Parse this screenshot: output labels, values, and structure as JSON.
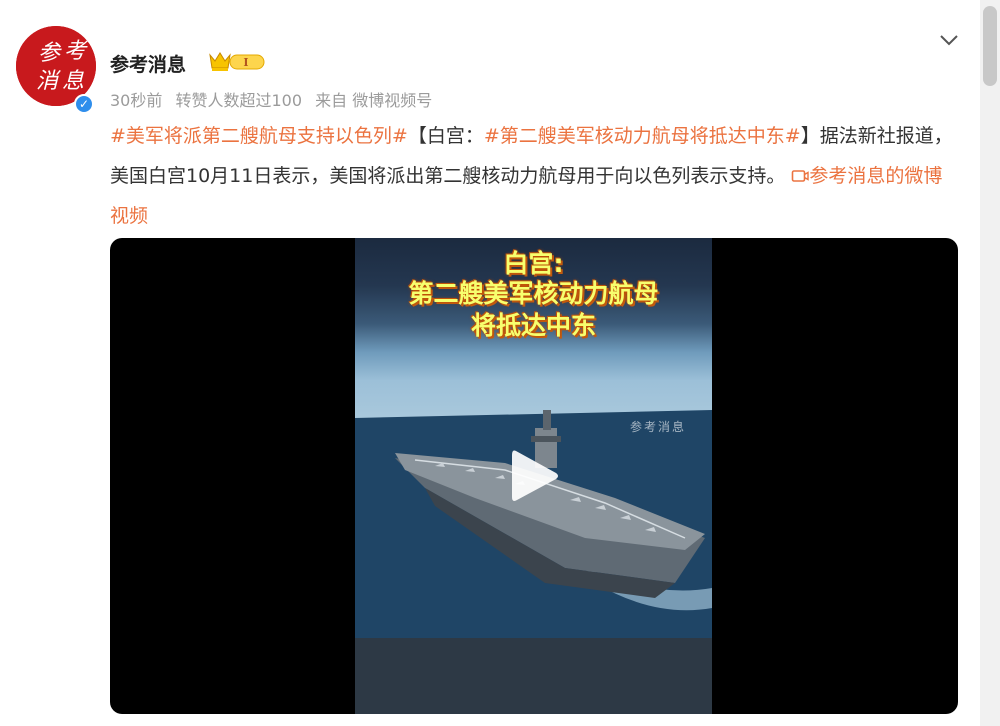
{
  "post": {
    "author": "参考消息",
    "meta": {
      "time": "30秒前",
      "reposts": "转赞人数超过100",
      "source": "来自 微博视频号"
    },
    "avatar_text": [
      "参",
      "考",
      "消",
      "息"
    ],
    "verified_icon": "verified-check-icon",
    "level_badge_icon": "crown-level-icon",
    "text": {
      "tag1": "#美军将派第二艘航母支持以色列#",
      "bracket_open": "【白宫：",
      "tag2": "#第二艘美军核动力航母将抵达中东#",
      "body": "】据法新社报道，美国白宫10月11日表示，美国将派出第二艘核动力航母用于向以色列表示支持。",
      "link": "参考消息的微博视频"
    }
  },
  "video": {
    "title_line1": "白宫:",
    "title_line2": "第二艘美军核动力航母",
    "title_line3": "将抵达中东",
    "watermark": "参考消息",
    "play_icon": "play-icon"
  },
  "colors": {
    "accent": "#eb7340",
    "avatar_red": "#c8191d",
    "verified_blue": "#2f8eec"
  }
}
